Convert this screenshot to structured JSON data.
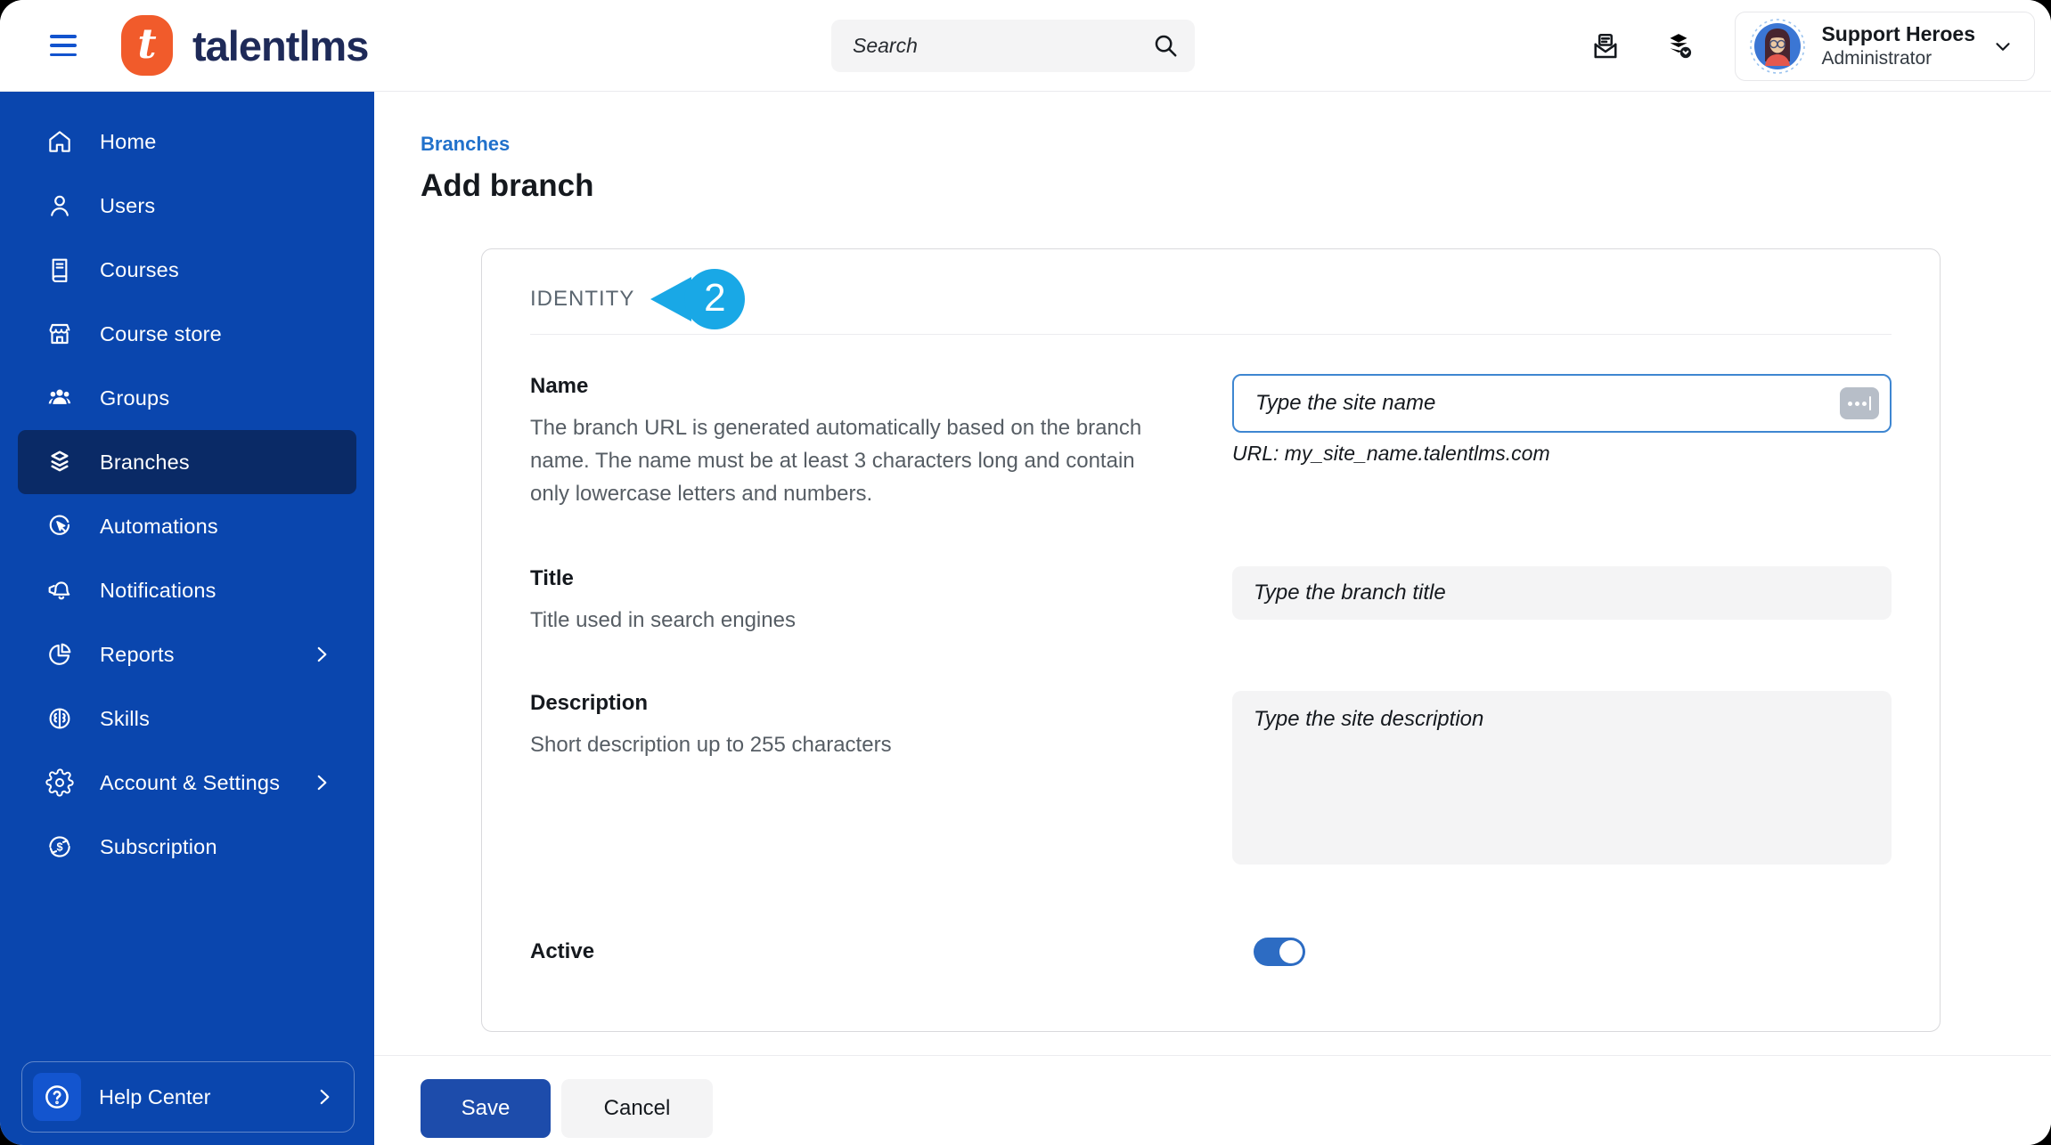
{
  "header": {
    "brand": "talentlms",
    "logo_letter": "t",
    "search": {
      "placeholder": "Search"
    },
    "user": {
      "name": "Support Heroes",
      "role": "Administrator"
    }
  },
  "sidebar": {
    "items": [
      {
        "label": "Home",
        "icon": "home-icon",
        "selected": false
      },
      {
        "label": "Users",
        "icon": "user-icon",
        "selected": false
      },
      {
        "label": "Courses",
        "icon": "book-icon",
        "selected": false
      },
      {
        "label": "Course store",
        "icon": "storefront-icon",
        "selected": false
      },
      {
        "label": "Groups",
        "icon": "group-icon",
        "selected": false
      },
      {
        "label": "Branches",
        "icon": "layers-icon",
        "selected": true
      },
      {
        "label": "Automations",
        "icon": "automation-icon",
        "selected": false
      },
      {
        "label": "Notifications",
        "icon": "bell-icon",
        "selected": false
      },
      {
        "label": "Reports",
        "icon": "pie-chart-icon",
        "selected": false,
        "has_submenu": true
      },
      {
        "label": "Skills",
        "icon": "brain-icon",
        "selected": false
      },
      {
        "label": "Account & Settings",
        "icon": "gear-icon",
        "selected": false,
        "has_submenu": true
      },
      {
        "label": "Subscription",
        "icon": "renew-dollar-icon",
        "selected": false
      }
    ],
    "help": {
      "label": "Help Center"
    }
  },
  "main": {
    "breadcrumb": "Branches",
    "page_title": "Add branch",
    "section": {
      "title": "IDENTITY",
      "callout_number": "2"
    },
    "form": {
      "name": {
        "label": "Name",
        "description": "The branch URL is generated automatically based on the branch name. The name must be at least 3 characters long and contain only lowercase letters and numbers.",
        "placeholder": "Type the site name",
        "helper": "URL: my_site_name.talentlms.com"
      },
      "title": {
        "label": "Title",
        "description": "Title used in search engines",
        "placeholder": "Type the branch title"
      },
      "description": {
        "label": "Description",
        "description": "Short description up to 255 characters",
        "placeholder": "Type the site description"
      },
      "active": {
        "label": "Active",
        "state": "on"
      }
    },
    "actions": {
      "save": "Save",
      "cancel": "Cancel"
    }
  },
  "colors": {
    "sidebar_blue": "#0a46ae",
    "sidebar_selected": "#0a2a66",
    "link_blue": "#2171cb",
    "save_blue": "#1d4cab",
    "callout_blue": "#19a8e6",
    "toggle_blue": "#2d6cc3",
    "logo_orange": "#f15b2b",
    "brand_navy": "#1e2a58"
  }
}
